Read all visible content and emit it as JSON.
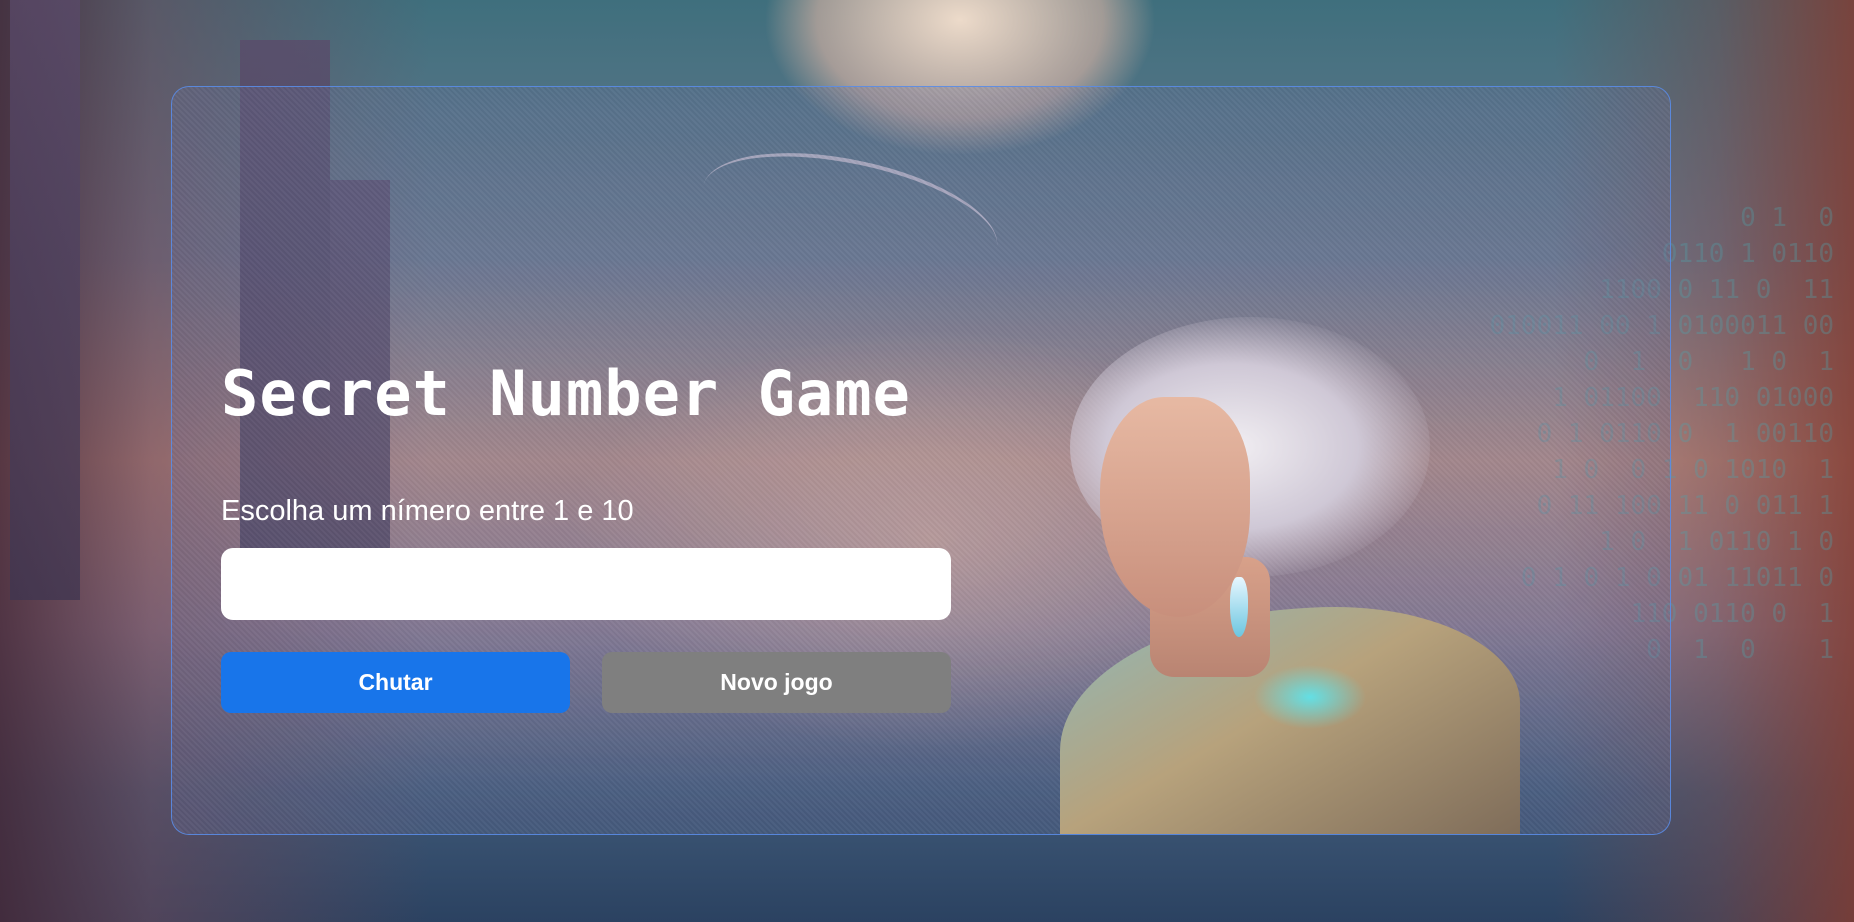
{
  "game": {
    "title": "Secret Number Game",
    "prompt": "Escolha um nímero entre 1 e 10",
    "input_value": "",
    "guess_button_label": "Chutar",
    "new_game_button_label": "Novo jogo"
  },
  "background": {
    "code_rain": "0 1  0\n0110 1 0110\n1100 0 11 0  11\n010011 00 1 0100011 00\n0  1  0   1 0  1\n1 01100  110 01000\n0 1 0110 0  1 00110\n1 0  0 1 0 1010  1\n0 11 100 11 0 011 1\n1 0  1 0110 1 0\n0 1 0 1 0 01 11011 0\n110 0110 0  1\n0  1  0    1"
  },
  "colors": {
    "guess_button": "#1875ea",
    "new_game_button": "#7f7f7f",
    "card_border": "#5a8ce6"
  }
}
